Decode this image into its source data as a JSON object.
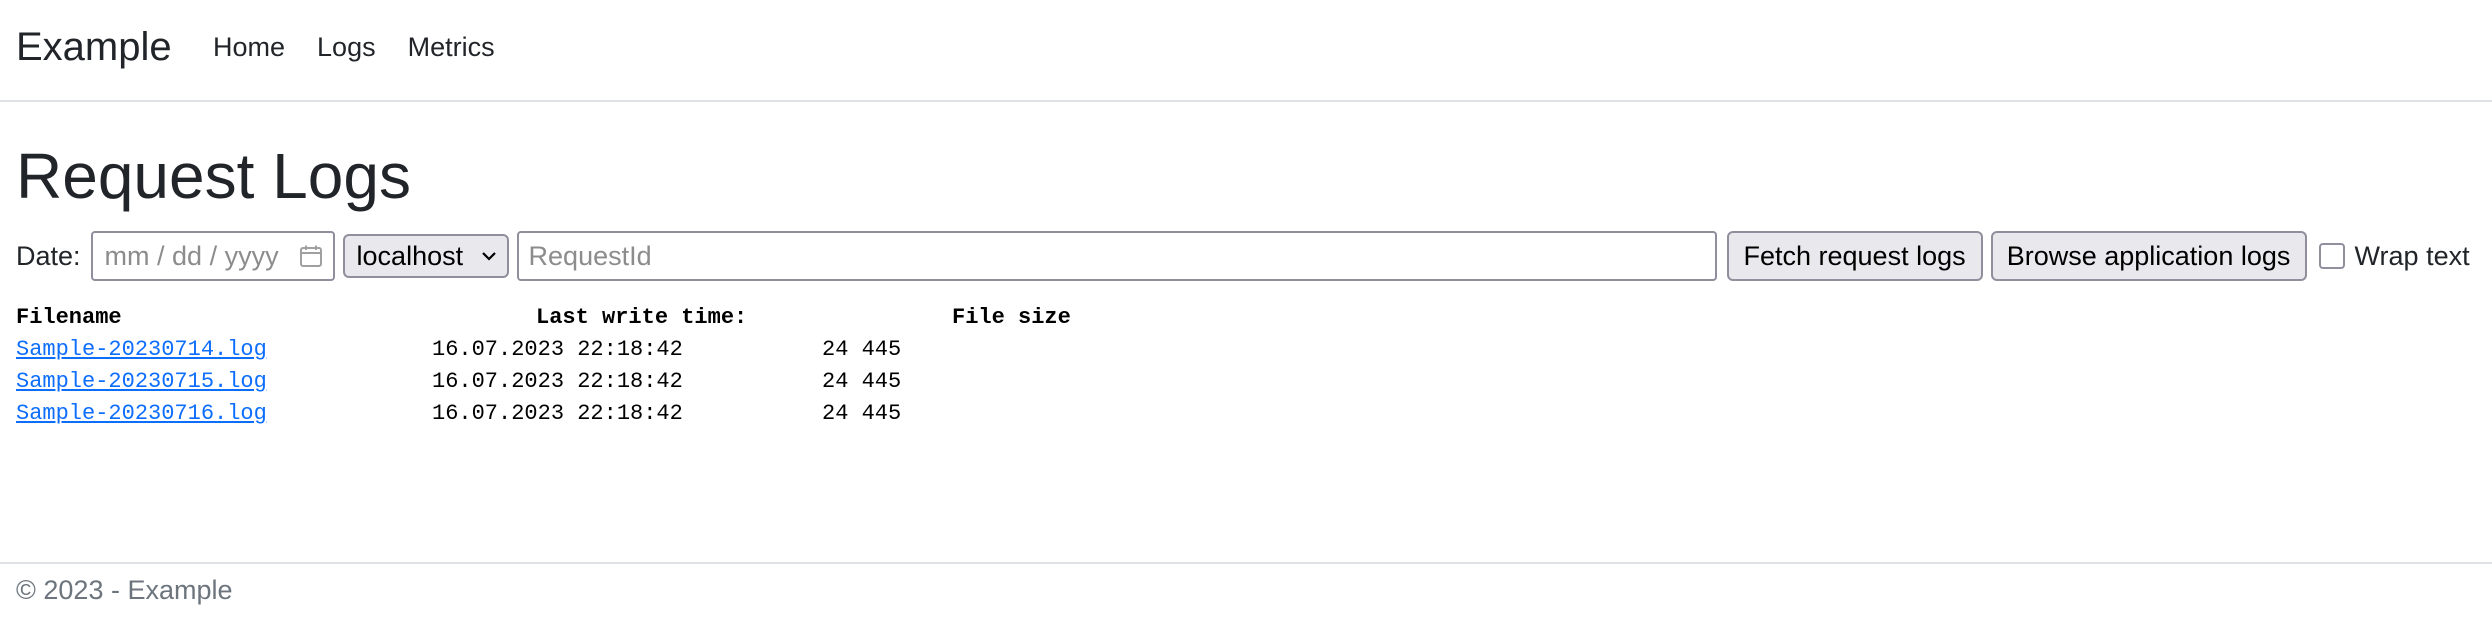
{
  "navbar": {
    "brand": "Example",
    "links": [
      "Home",
      "Logs",
      "Metrics"
    ]
  },
  "page": {
    "title": "Request Logs"
  },
  "filters": {
    "date_label": "Date:",
    "date_placeholder": "mm / dd / yyyy",
    "host_selected": "localhost",
    "request_placeholder": "RequestId",
    "fetch_button": "Fetch request logs",
    "browse_button": "Browse application logs",
    "wrap_label": "Wrap text",
    "wrap_checked": false
  },
  "table": {
    "headers": [
      "Filename",
      "Last write time:",
      "File size"
    ],
    "rows": [
      {
        "filename": "Sample-20230714.log",
        "time": "16.07.2023 22:18:42",
        "size": "24 445"
      },
      {
        "filename": "Sample-20230715.log",
        "time": "16.07.2023 22:18:42",
        "size": "24 445"
      },
      {
        "filename": "Sample-20230716.log",
        "time": "16.07.2023 22:18:42",
        "size": "24 445"
      }
    ]
  },
  "footer": {
    "text": "© 2023 - Example"
  },
  "icons": {
    "date_picker": "calendar-icon",
    "select_arrow": "chevron-down-icon"
  },
  "colors": {
    "link": "#0d6efd",
    "muted": "#6c757d",
    "border": "#dee2e6"
  }
}
